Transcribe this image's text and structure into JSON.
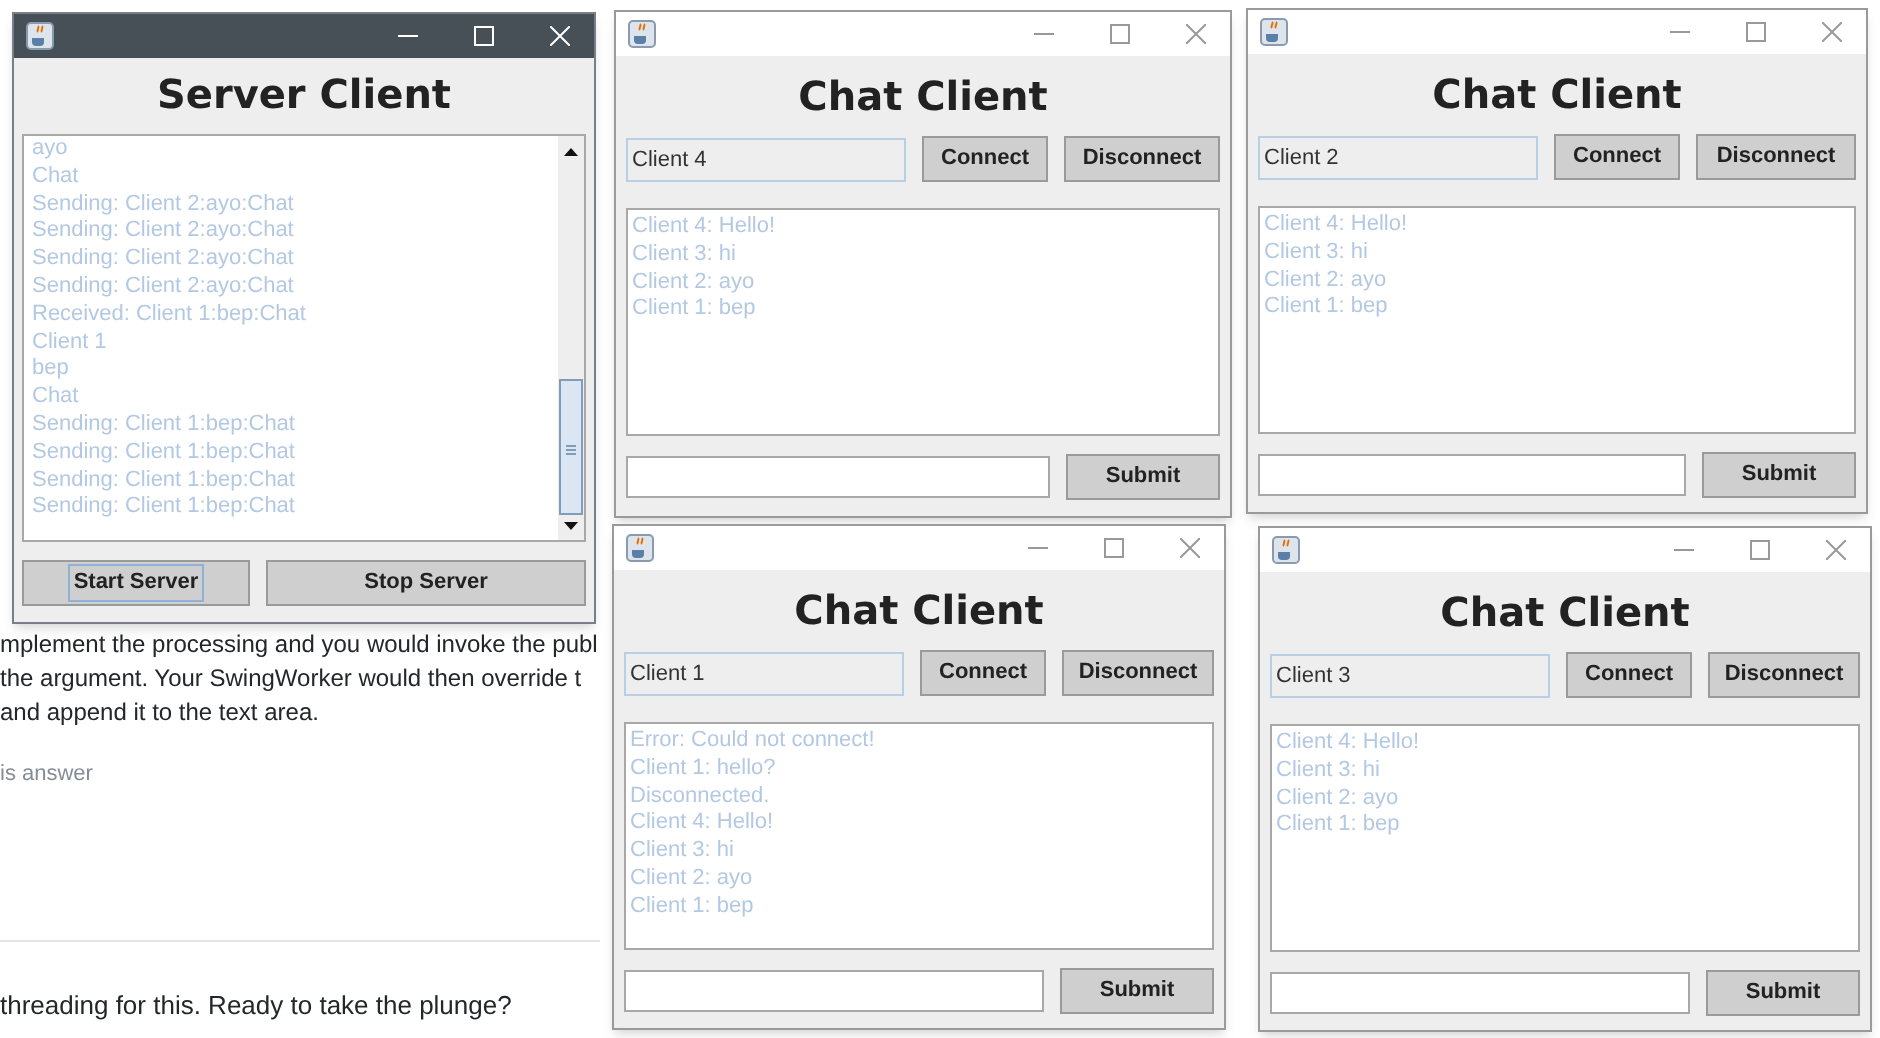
{
  "background_page": {
    "paragraph_lines": [
      "mplement the processing and you would invoke the publ",
      "the argument. Your SwingWorker would then override t",
      "and append it to the text area."
    ],
    "link": "is answer",
    "comment": "threading for this. Ready to take the plunge?"
  },
  "windows": [
    {
      "kind": "server",
      "active": true,
      "heading": "Server Client",
      "log": [
        "ayo",
        "Chat",
        "Sending: Client 2:ayo:Chat",
        "Sending: Client 2:ayo:Chat",
        "Sending: Client 2:ayo:Chat",
        "Sending: Client 2:ayo:Chat",
        "Received: Client 1:bep:Chat",
        "Client 1",
        "bep",
        "Chat",
        "Sending: Client 1:bep:Chat",
        "Sending: Client 1:bep:Chat",
        "Sending: Client 1:bep:Chat",
        "Sending: Client 1:bep:Chat"
      ],
      "buttons": [
        {
          "label": "Start Server",
          "focused": true
        },
        {
          "label": "Stop Server",
          "focused": false
        }
      ]
    },
    {
      "kind": "chat",
      "active": false,
      "heading": "Chat Client",
      "name_field": "Client 4",
      "buttons": [
        "Connect",
        "Disconnect"
      ],
      "messages": [
        "Client 4: Hello!",
        "Client 3: hi",
        "Client 2: ayo",
        "Client 1: bep"
      ],
      "submit": "Submit"
    },
    {
      "kind": "chat",
      "active": false,
      "heading": "Chat Client",
      "name_field": "Client 2",
      "buttons": [
        "Connect",
        "Disconnect"
      ],
      "messages": [
        "Client 4: Hello!",
        "Client 3: hi",
        "Client 2: ayo",
        "Client 1: bep"
      ],
      "submit": "Submit"
    },
    {
      "kind": "chat",
      "active": false,
      "heading": "Chat Client",
      "name_field": "Client 1",
      "buttons": [
        "Connect",
        "Disconnect"
      ],
      "messages": [
        "Error: Could not connect!",
        "Client 1: hello?",
        "Disconnected.",
        "Client 4: Hello!",
        "Client 3: hi",
        "Client 2: ayo",
        "Client 1: bep"
      ],
      "submit": "Submit"
    },
    {
      "kind": "chat",
      "active": false,
      "heading": "Chat Client",
      "name_field": "Client 3",
      "buttons": [
        "Connect",
        "Disconnect"
      ],
      "messages": [
        "Client 4: Hello!",
        "Client 3: hi",
        "Client 2: ayo",
        "Client 1: bep"
      ],
      "submit": "Submit"
    }
  ]
}
